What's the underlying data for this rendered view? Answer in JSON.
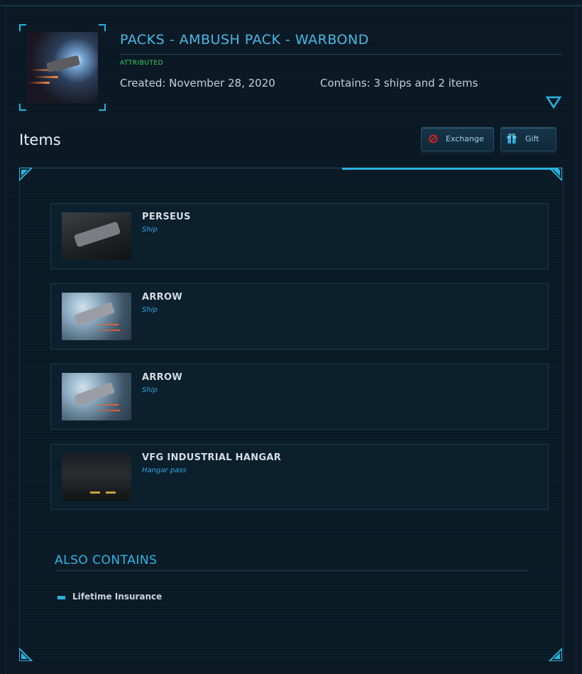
{
  "pack": {
    "title": "PACKS - AMBUSH PACK - WARBOND",
    "status": "ATTRIBUTED",
    "created": "Created: November 28, 2020",
    "contains": "Contains: 3 ships and 2 items"
  },
  "items_section": {
    "heading": "Items",
    "exchange_label": "Exchange",
    "gift_label": "Gift"
  },
  "items": [
    {
      "name": "PERSEUS",
      "type": "Ship"
    },
    {
      "name": "ARROW",
      "type": "Ship"
    },
    {
      "name": "ARROW",
      "type": "Ship"
    },
    {
      "name": "VFG INDUSTRIAL HANGAR",
      "type": "Hangar pass"
    }
  ],
  "also_contains": {
    "heading": "ALSO CONTAINS",
    "items": [
      "Lifetime Insurance"
    ]
  },
  "colors": {
    "accent": "#2ab3df",
    "attributed": "#3dd15a",
    "exchange_icon": "#e02020"
  },
  "icons": {
    "expand": "chevron-down-triangle-icon",
    "exchange": "no-entry-icon",
    "gift": "gift-box-icon"
  }
}
